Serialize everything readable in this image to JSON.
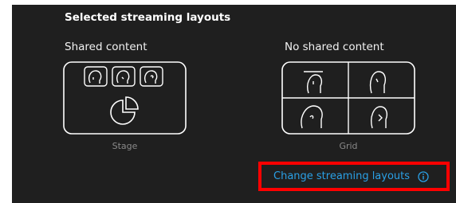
{
  "header": {
    "title": "Selected streaming layouts"
  },
  "options": {
    "shared": {
      "label": "Shared content",
      "caption": "Stage"
    },
    "no_shared": {
      "label": "No shared content",
      "caption": "Grid"
    }
  },
  "footer": {
    "change_link": "Change streaming layouts",
    "link_icon": "info-icon"
  },
  "colors": {
    "panel_bg": "#1f1f1f",
    "link": "#2aa0e6",
    "highlight_border": "#ff0000",
    "caption": "#8a8a8a"
  }
}
